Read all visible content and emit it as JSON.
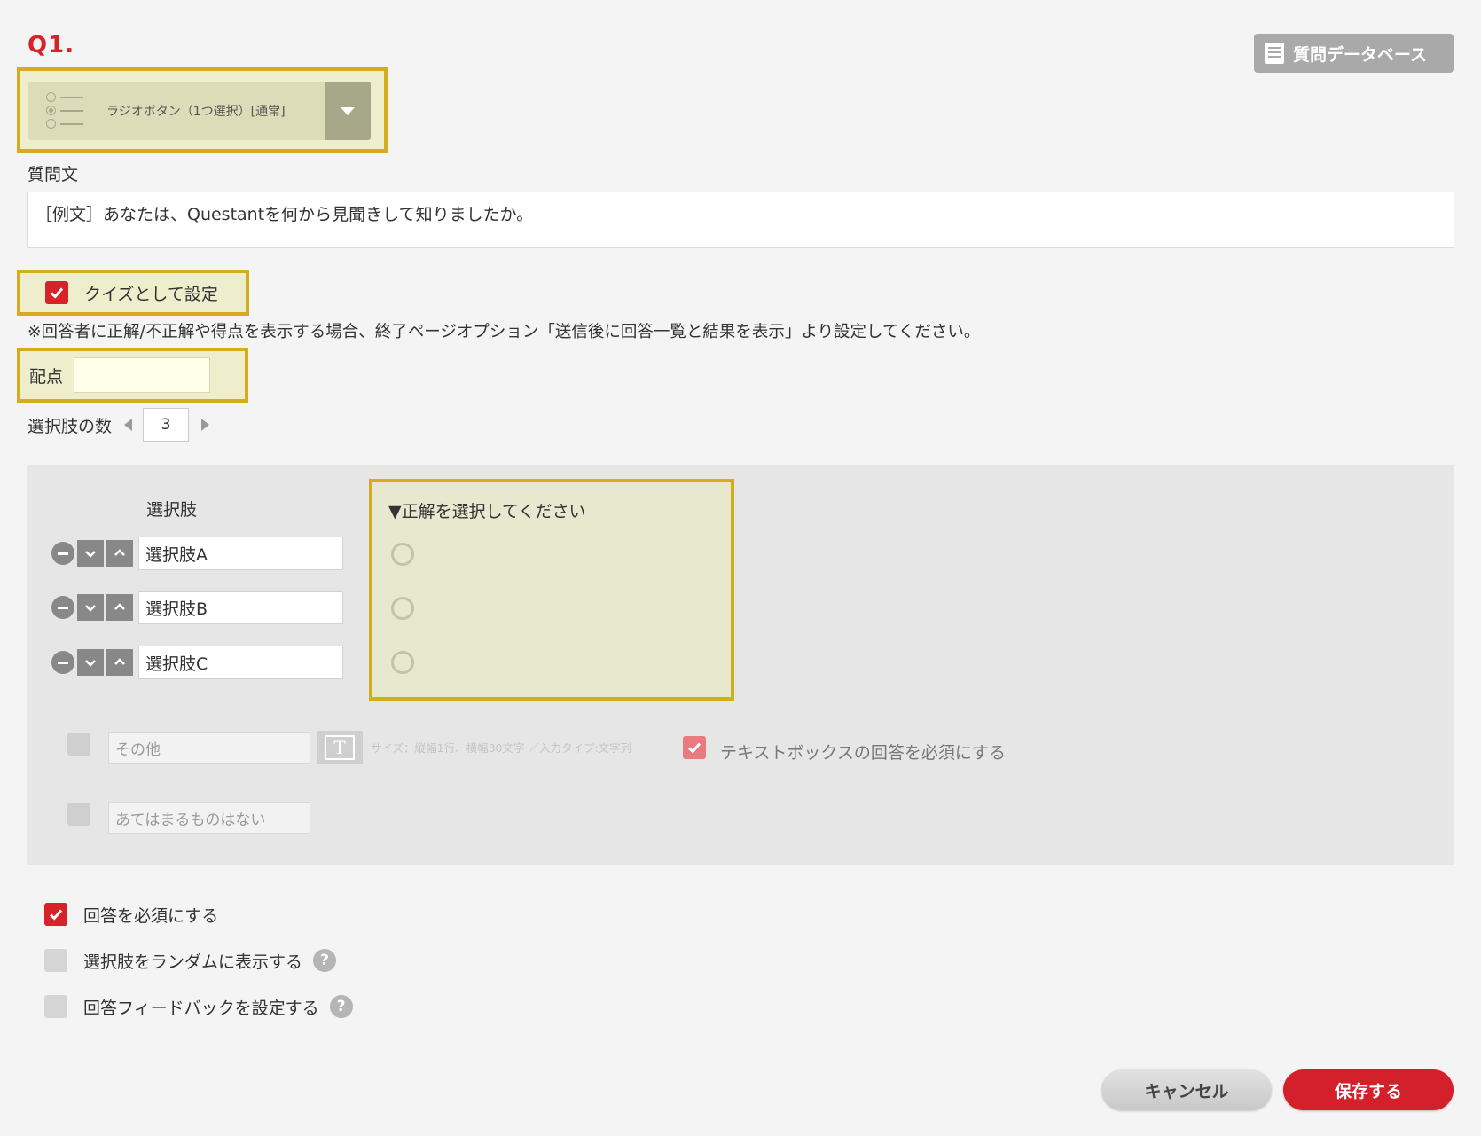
{
  "header": {
    "question_number": "Q1.",
    "database_button": "質問データベース"
  },
  "question_type": {
    "selected": "ラジオボタン（1つ選択）[通常]"
  },
  "question_text": {
    "label": "質問文",
    "value": "［例文］あなたは、Questantを何から見聞きして知りましたか。"
  },
  "quiz": {
    "label": "クイズとして設定",
    "checked": true,
    "note": "※回答者に正解/不正解や得点を表示する場合、終了ページオプション「送信後に回答一覧と結果を表示」より設定してください。",
    "points_label": "配点",
    "points_value": ""
  },
  "choice_count": {
    "label": "選択肢の数",
    "value": "3"
  },
  "choices": {
    "header": "選択肢",
    "items": [
      "選択肢A",
      "選択肢B",
      "選択肢C"
    ],
    "correct_title": "▼正解を選択してください"
  },
  "extras": {
    "other_placeholder": "その他",
    "size_hint": "サイズ：縦幅1行、横幅30文字 ／入力タイプ:文字列",
    "require_text_label": "テキストボックスの回答を必須にする",
    "none_placeholder": "あてはまるものはない"
  },
  "options": {
    "required": "回答を必須にする",
    "randomize": "選択肢をランダムに表示する",
    "feedback": "回答フィードバックを設定する",
    "help_glyph": "?"
  },
  "footer": {
    "cancel": "キャンセル",
    "save": "保存する"
  },
  "colors": {
    "accent_red": "#d8222a",
    "highlight_border": "#d4ad1e",
    "highlight_fill": "#eeeecd"
  }
}
